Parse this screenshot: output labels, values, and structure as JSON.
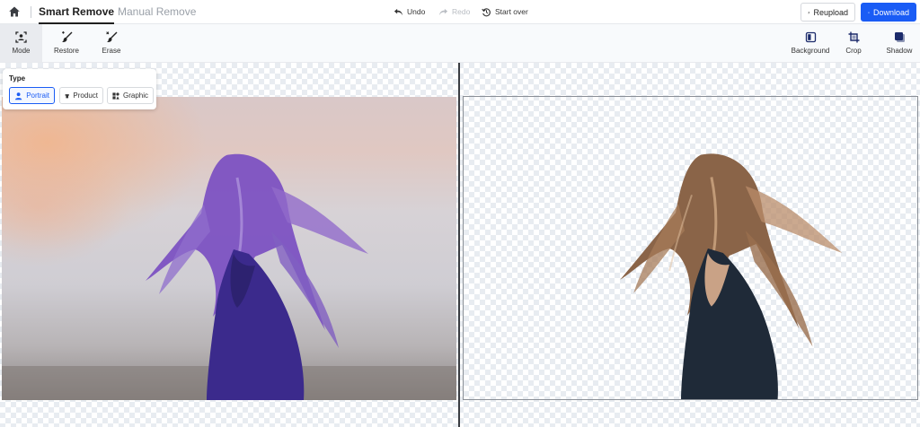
{
  "header": {
    "tabs": [
      {
        "label": "Smart Remove",
        "active": true
      },
      {
        "label": "Manual Remove",
        "active": false
      }
    ],
    "history": {
      "undo": "Undo",
      "redo": "Redo",
      "start_over": "Start over"
    },
    "actions": {
      "reupload": "Reupload",
      "download": "Download"
    }
  },
  "toolbar": {
    "left": [
      {
        "label": "Mode",
        "icon": "mode-icon",
        "active": true
      },
      {
        "label": "Restore",
        "icon": "restore-brush-icon"
      },
      {
        "label": "Erase",
        "icon": "erase-brush-icon"
      }
    ],
    "right": [
      {
        "label": "Background",
        "icon": "background-icon"
      },
      {
        "label": "Crop",
        "icon": "crop-icon"
      },
      {
        "label": "Shadow",
        "icon": "shadow-icon"
      }
    ]
  },
  "type_panel": {
    "title": "Type",
    "options": [
      {
        "label": "Portrait",
        "icon": "person-icon",
        "selected": true
      },
      {
        "label": "Product",
        "icon": "shirt-icon"
      },
      {
        "label": "Graphic",
        "icon": "shapes-icon"
      }
    ]
  },
  "colors": {
    "accent": "#1a5cf5",
    "splitter": "#3a3d42"
  }
}
